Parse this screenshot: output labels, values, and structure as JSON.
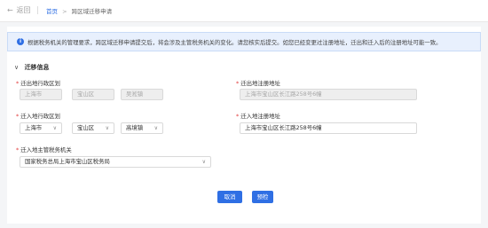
{
  "header": {
    "back_icon": "left-arrow-icon",
    "back_label": "返回",
    "breadcrumb": {
      "home": "首页",
      "separator": ">",
      "current": "跨区域迁移申请"
    }
  },
  "alert": {
    "icon": "info-icon",
    "text": "根据税务机关的管理要求，跨区域迁移申请提交后，将会涉及主管税务机关的变化。请您核实后提交。如您已经变更过注册地址，迁出和迁入后的注册地址可能一致。"
  },
  "section": {
    "title": "迁移信息",
    "chevron": "chevron-down-icon"
  },
  "out": {
    "region_label": "迁出地行政区划",
    "province": "上海市",
    "district": "宝山区",
    "town": "吴淞镇",
    "address_label": "迁出地注册地址",
    "address": "上海市宝山区长江路258号6幢"
  },
  "in": {
    "region_label": "迁入地行政区划",
    "province": "上海市",
    "district": "宝山区",
    "town": "高境镇",
    "address_label": "迁入地注册地址",
    "address": "上海市宝山区长江路258号6幢",
    "authority_label": "迁入地主管税务机关",
    "authority": "国家税务总局上海市宝山区税务局"
  },
  "buttons": {
    "cancel": "取消",
    "precheck": "预检"
  },
  "colors": {
    "accent": "#2f6fe4",
    "required": "#e23b3b"
  }
}
